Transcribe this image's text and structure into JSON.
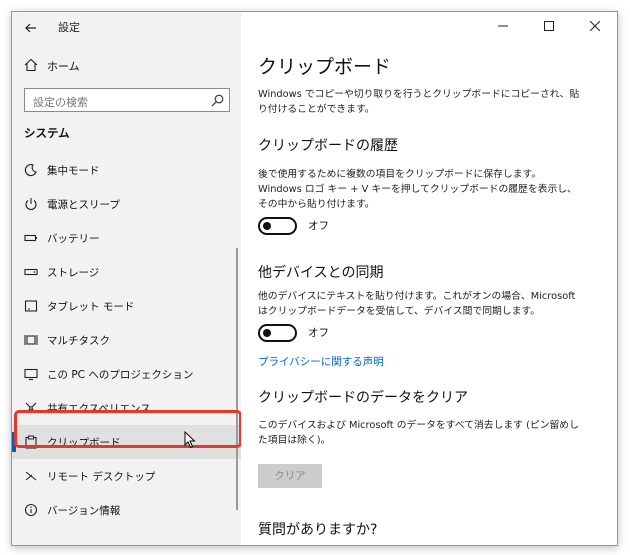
{
  "window": {
    "title": "設定"
  },
  "sidebar": {
    "home_label": "ホーム",
    "search_placeholder": "設定の検索",
    "section_title": "システム",
    "items": [
      {
        "label": "集中モード",
        "icon": "focus-assist-icon"
      },
      {
        "label": "電源とスリープ",
        "icon": "power-icon"
      },
      {
        "label": "バッテリー",
        "icon": "battery-icon"
      },
      {
        "label": "ストレージ",
        "icon": "storage-icon"
      },
      {
        "label": "タブレット モード",
        "icon": "tablet-icon"
      },
      {
        "label": "マルチタスク",
        "icon": "multitask-icon"
      },
      {
        "label": "この PC へのプロジェクション",
        "icon": "projection-icon"
      },
      {
        "label": "共有エクスペリエンス",
        "icon": "shared-experiences-icon"
      },
      {
        "label": "クリップボード",
        "icon": "clipboard-icon",
        "active": true
      },
      {
        "label": "リモート デスクトップ",
        "icon": "remote-desktop-icon"
      },
      {
        "label": "バージョン情報",
        "icon": "info-icon"
      }
    ]
  },
  "content": {
    "page_title": "クリップボード",
    "intro": "Windows でコピーや切り取りを行うとクリップボードにコピーされ、貼り付けることができます。",
    "history": {
      "heading": "クリップボードの履歴",
      "description": "後で使用するために複数の項目をクリップボードに保存します。Windows ロゴ キー + V キーを押してクリップボードの履歴を表示し、その中から貼り付けます。",
      "toggle_label": "オフ",
      "toggle_on": false
    },
    "sync": {
      "heading": "他デバイスとの同期",
      "description": "他のデバイスにテキストを貼り付けます。これがオンの場合、Microsoft はクリップボードデータを受信して、デバイス間で同期します。",
      "toggle_label": "オフ",
      "toggle_on": false
    },
    "privacy_link": "プライバシーに関する声明",
    "clear": {
      "heading": "クリップボードのデータをクリア",
      "description": "このデバイスおよび Microsoft のデータをすべて消去します (ピン留めした項目は除く)。",
      "button_label": "クリア"
    },
    "questions_heading": "質問がありますか?"
  },
  "colors": {
    "accent": "#0063b1",
    "link": "#0066cc",
    "highlight": "#e2392c"
  }
}
